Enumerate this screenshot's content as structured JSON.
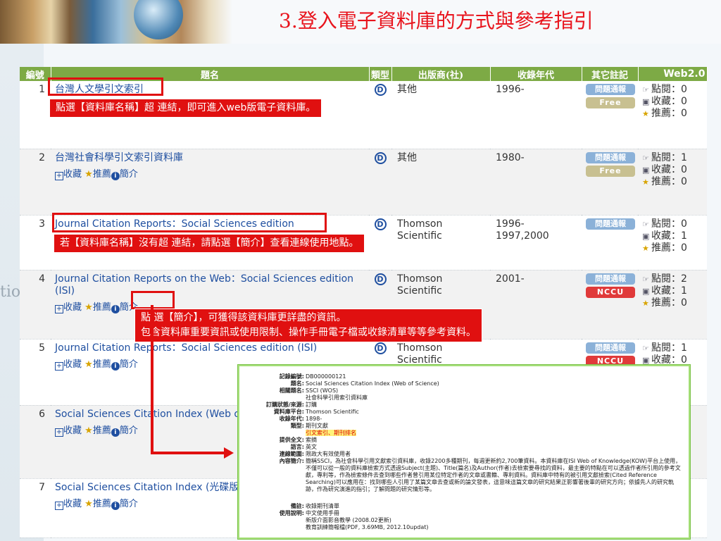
{
  "slide_title": "3.登入電子資料庫的方式與參考指引",
  "side_text": "tio",
  "table": {
    "headers": {
      "num": "編號",
      "title": "題名",
      "type": "類型",
      "publisher": "出版商(社)",
      "years": "收錄年代",
      "notes": "其它註記",
      "web": "Web2.0"
    },
    "type_icon": "D",
    "action_labels": {
      "collect": "收藏",
      "recommend": "推薦",
      "intro": "簡介"
    },
    "web_labels": {
      "clicks": "點閱：",
      "saves": "收藏：",
      "recs": "推薦："
    },
    "rows": [
      {
        "num": "1",
        "title": "台灣人文學引文索引",
        "publisher": "其他",
        "years": "1996-",
        "badges": [
          "問題通報",
          "Free"
        ],
        "clicks": "0",
        "saves": "0",
        "recs": "0"
      },
      {
        "num": "2",
        "title": "台灣社會科學引文索引資料庫",
        "publisher": "其他",
        "years": "1980-",
        "badges": [
          "問題通報",
          "Free"
        ],
        "clicks": "1",
        "saves": "0",
        "recs": "0"
      },
      {
        "num": "3",
        "title": "Journal Citation Reports：Social Sciences edition",
        "publisher": "Thomson Scientific",
        "years": "1996-\n1997,2000",
        "badges": [
          "問題通報"
        ],
        "clicks": "0",
        "saves": "1",
        "recs": "0"
      },
      {
        "num": "4",
        "title": "Journal Citation Reports on the Web：Social Sciences edition (ISI)",
        "publisher": "Thomson Scientific",
        "years": "2001-",
        "badges": [
          "問題通報",
          "NCCU"
        ],
        "clicks": "2",
        "saves": "1",
        "recs": "0"
      },
      {
        "num": "5",
        "title": "Journal Citation Reports：Social Sciences edition (ISI)",
        "publisher": "Thomson Scientific",
        "years": "",
        "badges": [
          "問題通報",
          "NCCU"
        ],
        "clicks": "1",
        "saves": "0",
        "recs": ""
      },
      {
        "num": "6",
        "title": "Social Sciences Citation Index (Web of Science)",
        "publisher": "",
        "years": "",
        "badges": [],
        "clicks": "",
        "saves": "",
        "recs": ""
      },
      {
        "num": "7",
        "title": "Social Sciences Citation Index (光碟版)",
        "publisher": "",
        "years": "",
        "badges": [],
        "clicks": "",
        "saves": "",
        "recs": ""
      }
    ]
  },
  "callouts": {
    "c1": "點選【資料庫名稱】超 連結，即可進入web版電子資料庫。",
    "c2": "若【資料庫名稱】沒有超 連結，請點選【簡介】查看連線使用地點。",
    "c3_line1": "點 選【簡介】，可獲得該資料庫更詳盡的資訊。",
    "c3_line2": "包含資料庫重要資訊或使用限制、操作手冊電子檔或收錄清單等等參考資料。"
  },
  "detail": {
    "rows": [
      {
        "label": "記錄編號:",
        "value": "DB000000121"
      },
      {
        "label": "題名:",
        "value": "Social Sciences Citation Index (Web of Science)"
      },
      {
        "label": "相關題名:",
        "value": "SSCI (WOS)"
      },
      {
        "label": "",
        "value": "社會科學引用索引資料庫"
      },
      {
        "label": "訂購狀態/來源:",
        "value": "訂購"
      },
      {
        "label": "資料庫平台:",
        "value": "Thomson Scientific"
      },
      {
        "label": "收錄年代:",
        "value": "1898-"
      },
      {
        "label": "類型:",
        "value": "期刊文獻"
      },
      {
        "label": "",
        "value": "引文索引、期刊排名",
        "highlight": true
      },
      {
        "label": "提供全文:",
        "value": "索摘"
      },
      {
        "label": "語言:",
        "value": "英文"
      },
      {
        "label": "連線範圍:",
        "value": "限政大有效使用者"
      },
      {
        "label": "內容簡介:",
        "value": "簡稱SSCI，為社會科學引用文獻索引資料庫，收錄2200多種期刊，每週更新約2,700筆資料。本資料庫在ISI Web of Knowledge(KOW)平台上使用，不僅可以從一般的資料庫檢索方式透過Subject(主題)、Title(篇名)及Author(作者)去檢索要尋找的資料，最主要的特點在可以透過作者所引用的參考文獻，專利等，作為檢索條件去查到哪些作者曾引用某位特定作者的文章或書籍、專利資料。資料庫中特有的被引用文獻檢索(Cited Reference Searching)可以應用在：找到哪些人引用了某篇文章去查或新的論文發表，這意味這篇文章的研究結果正影響著後輩的研究方向；依據先人的研究軌跡，作為研究演進的指引；了解問題的研究情形等。"
      },
      {
        "label": "備註:",
        "value": "收錄期刊清單"
      },
      {
        "label": "使用說明:",
        "value": "中文使用手冊"
      },
      {
        "label": "",
        "value": "新版介面影音教學 (2008.02更新)"
      },
      {
        "label": "",
        "value": "教育訓練簡報檔(PDF, 3.69MB, 2012.10updat)"
      }
    ]
  }
}
